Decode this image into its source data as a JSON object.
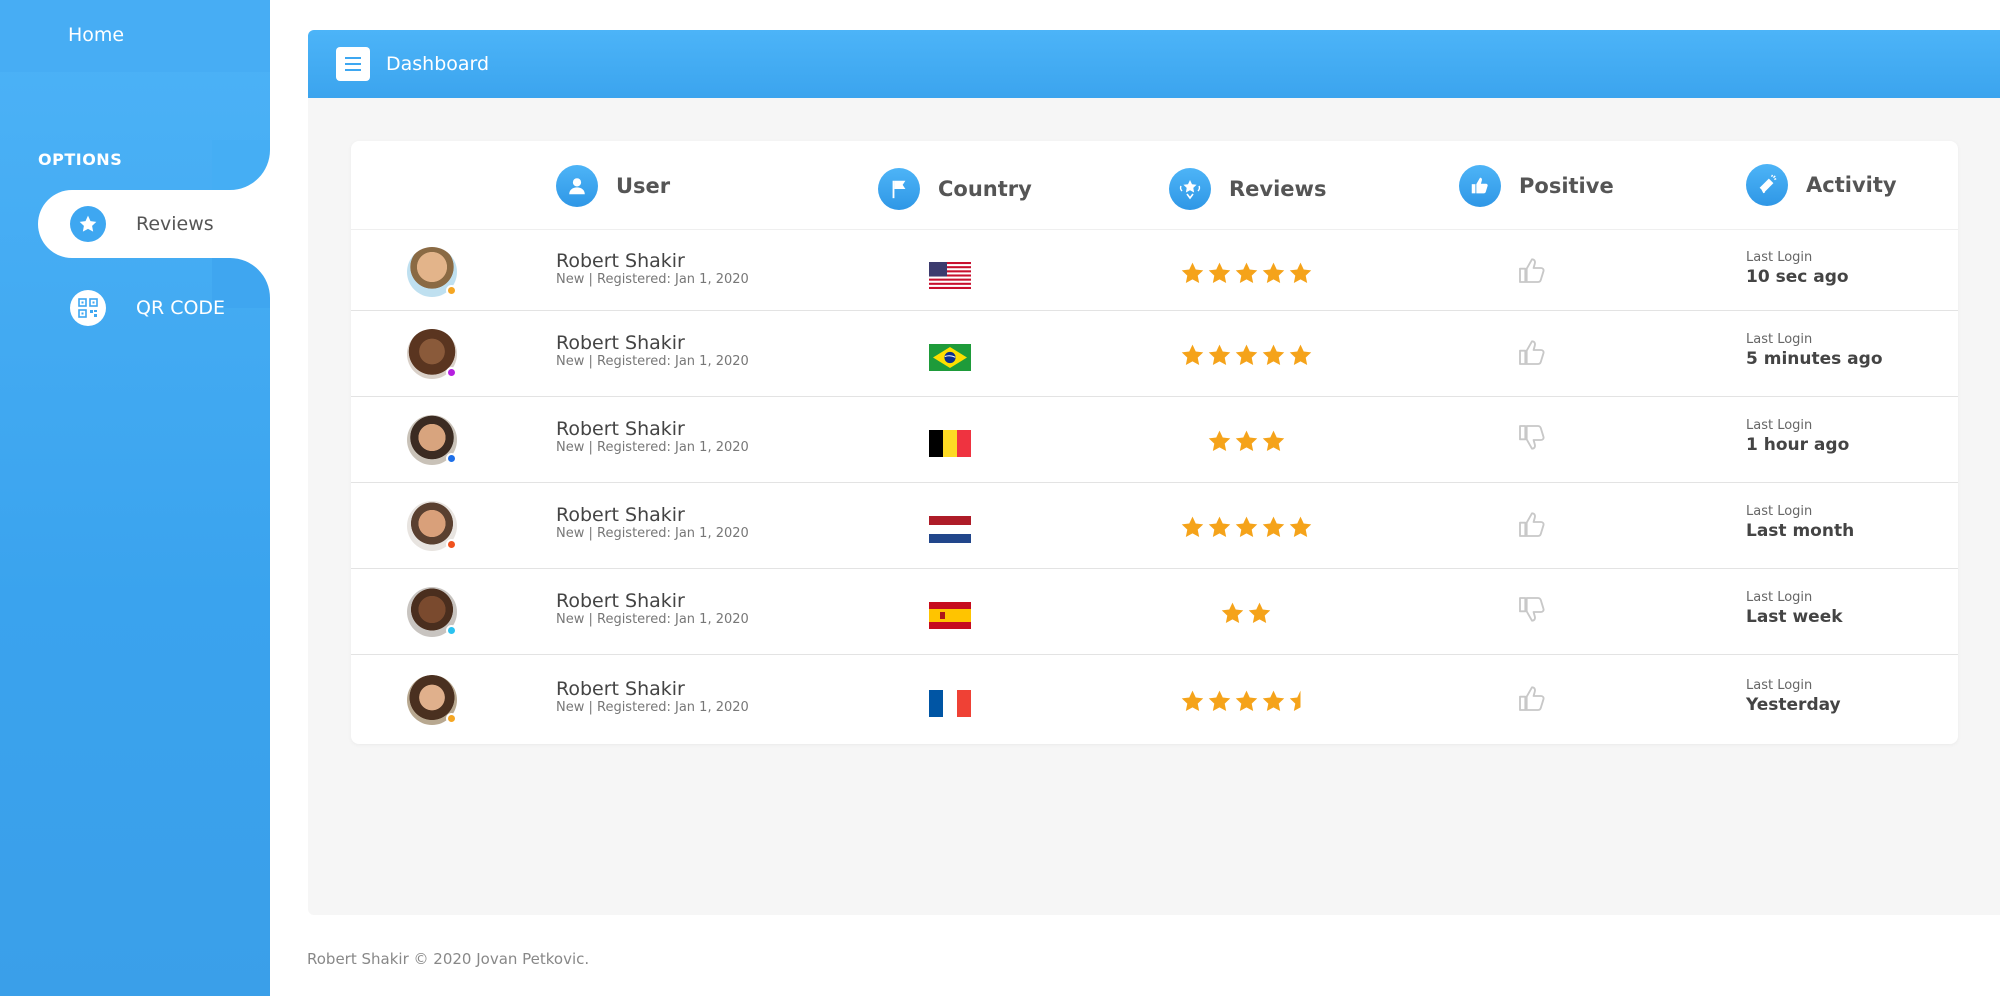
{
  "sidebar": {
    "home": "Home",
    "options_label": "OPTIONS",
    "items": [
      {
        "label": "Reviews",
        "icon": "star-icon",
        "active": true
      },
      {
        "label": "QR CODE",
        "icon": "qr-code-icon",
        "active": false
      }
    ]
  },
  "topbar": {
    "title": "Dashboard"
  },
  "table": {
    "headers": [
      {
        "label": "User",
        "icon": "user-icon"
      },
      {
        "label": "Country",
        "icon": "flag-icon"
      },
      {
        "label": "Reviews",
        "icon": "review-badge-icon"
      },
      {
        "label": "Positive",
        "icon": "thumbs-up-icon"
      },
      {
        "label": "Activity",
        "icon": "megaphone-icon"
      }
    ],
    "rows": [
      {
        "name": "Robert Shakir",
        "sub": "New | Registered: Jan 1, 2020",
        "country": "United States",
        "rating": 5,
        "positive": true,
        "activity_label": "Last Login",
        "activity_value": "10 sec ago",
        "status_color": "#f5a623"
      },
      {
        "name": "Robert Shakir",
        "sub": "New | Registered: Jan 1, 2020",
        "country": "Brazil",
        "rating": 5,
        "positive": true,
        "activity_label": "Last Login",
        "activity_value": "5 minutes ago",
        "status_color": "#b620e0"
      },
      {
        "name": "Robert Shakir",
        "sub": "New | Registered: Jan 1, 2020",
        "country": "Belgium",
        "rating": 3,
        "positive": false,
        "activity_label": "Last Login",
        "activity_value": "1 hour ago",
        "status_color": "#1e6fe8"
      },
      {
        "name": "Robert Shakir",
        "sub": "New | Registered: Jan 1, 2020",
        "country": "Netherlands",
        "rating": 5,
        "positive": true,
        "activity_label": "Last Login",
        "activity_value": "Last month",
        "status_color": "#f0521e"
      },
      {
        "name": "Robert Shakir",
        "sub": "New | Registered: Jan 1, 2020",
        "country": "Spain",
        "rating": 2,
        "positive": false,
        "activity_label": "Last Login",
        "activity_value": "Last week",
        "status_color": "#2bc2f0"
      },
      {
        "name": "Robert Shakir",
        "sub": "New | Registered: Jan 1, 2020",
        "country": "France",
        "rating": 4.5,
        "positive": true,
        "activity_label": "Last Login",
        "activity_value": "Yesterday",
        "status_color": "#f5a623"
      }
    ]
  },
  "footer": "Robert Shakir © 2020 Jovan Petkovic.",
  "colors": {
    "accent": "#3ea7f1",
    "star": "#f5a31a",
    "thumb": "#c8c8c8"
  }
}
